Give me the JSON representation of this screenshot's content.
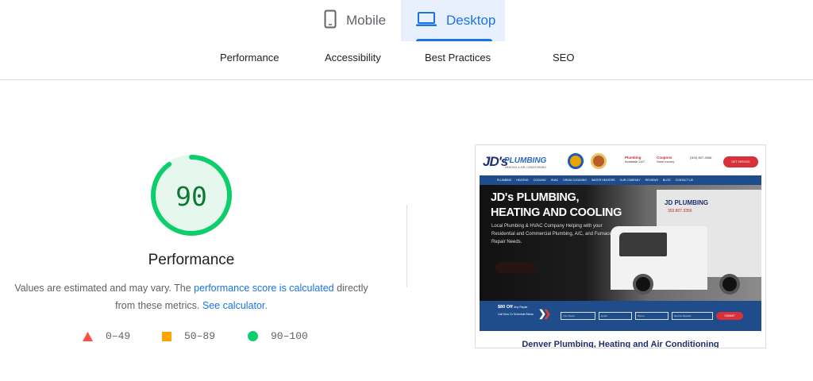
{
  "device_tabs": [
    {
      "label": "Mobile",
      "icon": "smartphone-icon",
      "selected": false
    },
    {
      "label": "Desktop",
      "icon": "laptop-icon",
      "selected": true
    }
  ],
  "category_tabs": [
    "Performance",
    "Accessibility",
    "Best Practices",
    "SEO"
  ],
  "performance": {
    "score": "90",
    "score_fraction": 0.9,
    "title": "Performance",
    "description_before": "Values are estimated and may vary. The ",
    "description_link1": "performance score is calculated",
    "description_middle": " directly from these metrics. ",
    "description_link2": "See calculator."
  },
  "legend": [
    {
      "range": "0–49",
      "shape": "triangle",
      "color": "#ff4e42"
    },
    {
      "range": "50–89",
      "shape": "square",
      "color": "#ffa400"
    },
    {
      "range": "90–100",
      "shape": "circle",
      "color": "#0cce6b"
    }
  ],
  "colors": {
    "accent": "#1a73e8",
    "pass": "#0cce6b",
    "pass_text": "#0c7a35",
    "average": "#ffa400",
    "fail": "#ff4e42"
  },
  "screenshot": {
    "logo_main": "JD's",
    "logo_brand": "PLUMBING",
    "logo_sub": "HEATING & AIR CONDITIONING",
    "services": [
      {
        "name": "Plumbing",
        "note": "Available 24/7"
      },
      {
        "name": "Coupons",
        "note": "Save money"
      }
    ],
    "phone": "(303) 807-3356",
    "cta": "GET SERVICE",
    "nav": [
      "PLUMBING",
      "HEATING",
      "COOLING",
      "HVAC",
      "DRAIN CLEANING",
      "WATER HEATERS",
      "OUR COMPANY",
      "REVIEWS",
      "BLOG",
      "CONTACT US"
    ],
    "hero_title_line1": "JD's PLUMBING,",
    "hero_title_line2": "HEATING AND COOLING",
    "hero_text": "Local Plumbing & HVAC Company Helping with your Residential and Commercial Plumbing, A/C, and Furnace Repair Needs.",
    "truck_brand": "JD PLUMBING",
    "truck_phone": "303.807.3356",
    "offer": "$80 Off",
    "offer_detail": "Any Repair",
    "offer_sub": "Call Now Or Schedule Below",
    "form_fields": [
      "Your Name",
      "Email",
      "Phone",
      "Service Needed"
    ],
    "submit": "SUBMIT",
    "footer_heading": "Denver Plumbing, Heating and Air Conditioning"
  }
}
